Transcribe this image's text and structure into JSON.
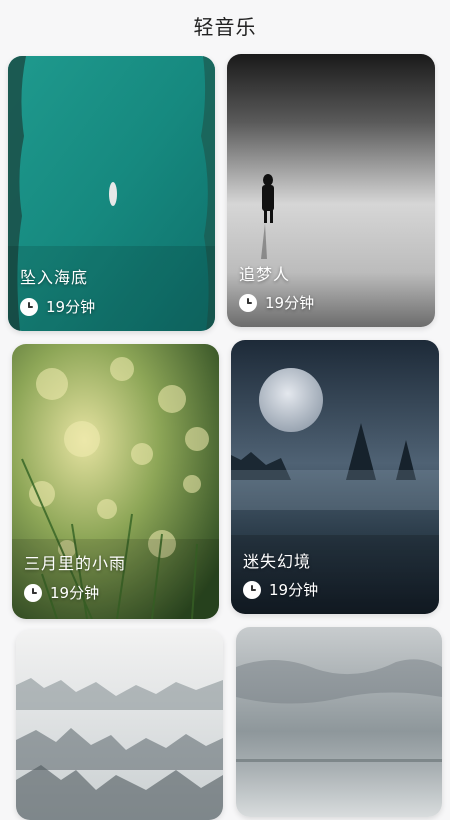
{
  "app": {
    "title": "轻音乐"
  },
  "cards": [
    {
      "title": "坠入海底",
      "duration": "19分钟"
    },
    {
      "title": "追梦人",
      "duration": "19分钟"
    },
    {
      "title": "三月里的小雨",
      "duration": "19分钟"
    },
    {
      "title": "迷失幻境",
      "duration": "19分钟"
    },
    {
      "title": "",
      "duration": ""
    },
    {
      "title": "",
      "duration": ""
    }
  ],
  "icons": {
    "duration": "clock-icon"
  },
  "colors": {
    "text_primary": "#222222",
    "overlay_text": "#ffffff",
    "background": "#f7f7f8"
  }
}
